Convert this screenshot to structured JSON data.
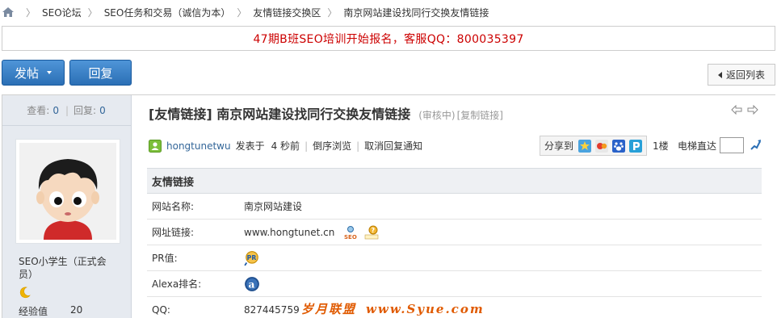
{
  "breadcrumb": {
    "items": [
      "SEO论坛",
      "SEO任务和交易（诚信为本）",
      "友情链接交换区",
      "南京网站建设找同行交换友情链接"
    ],
    "separator": "〉"
  },
  "notice": {
    "text": "47期B班SEO培训开始报名，客服QQ：800035397",
    "color": "#cc0000"
  },
  "toolbar": {
    "post_label": "发帖",
    "reply_label": "回复",
    "back_label": "返回列表"
  },
  "stats": {
    "views_label": "查看:",
    "views": "0",
    "replies_label": "回复:",
    "replies": "0"
  },
  "user": {
    "level": "SEO小学生（正式会员）",
    "exp_label": "经验值",
    "exp_value": "20"
  },
  "thread": {
    "title": "[友情链接] 南京网站建设找同行交换友情链接",
    "status": "(审核中)",
    "copy_link": "[复制链接]"
  },
  "post_info": {
    "author": "hongtunetwu",
    "posted_label": "发表于",
    "time": "4 秒前",
    "reverse": "倒序浏览",
    "cancel_notify": "取消回复通知",
    "share_label": "分享到",
    "floor": "1楼",
    "elevator_label": "电梯直达"
  },
  "table": {
    "title": "友情链接",
    "rows": [
      {
        "label": "网站名称:",
        "value": "南京网站建设"
      },
      {
        "label": "网址链接:",
        "value": "www.hongtunet.cn"
      },
      {
        "label": "PR值:",
        "value": ""
      },
      {
        "label": "Alexa排名:",
        "value": ""
      },
      {
        "label": "QQ:",
        "value": "827445759"
      }
    ]
  },
  "watermark": {
    "part1": "岁月联盟",
    "part2": "www.Syue.com"
  },
  "colors": {
    "accent": "#2b6fb5",
    "link": "#336699",
    "sidebar_bg": "#e6eaf0",
    "notice_text": "#cc0000"
  }
}
